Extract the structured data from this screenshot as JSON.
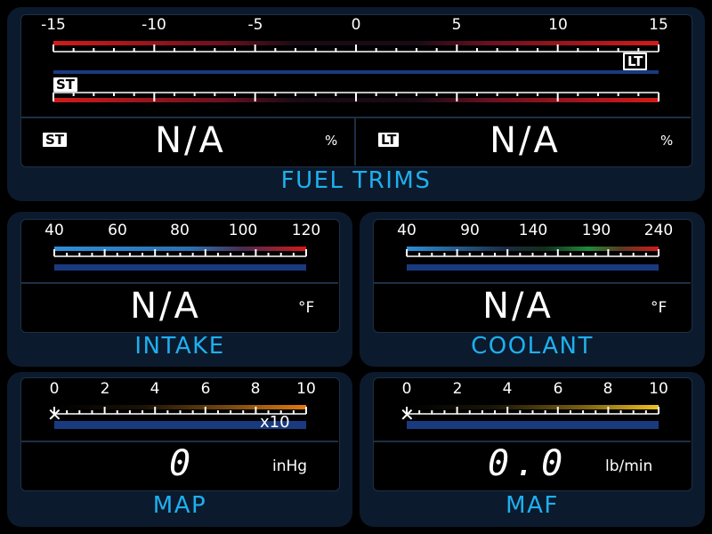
{
  "colors": {
    "accent": "#1eb0ee",
    "panel": "#0c1a2e",
    "bar_track": "#1a3a80",
    "red": "#d41a1a",
    "blue": "#2d8fd8",
    "orange": "#e07a10",
    "yellow": "#f0c020",
    "green": "#1f8a3a"
  },
  "fuel_trims": {
    "label": "FUEL TRIMS",
    "scale": [
      "-15",
      "-10",
      "-5",
      "0",
      "5",
      "10",
      "15"
    ],
    "lt_badge": "LT",
    "st_badge": "ST",
    "st": {
      "badge": "ST",
      "value": "N/A",
      "unit": "%"
    },
    "lt": {
      "badge": "LT",
      "value": "N/A",
      "unit": "%"
    }
  },
  "intake": {
    "label": "INTAKE",
    "scale": [
      "40",
      "60",
      "80",
      "100",
      "120"
    ],
    "value": "N/A",
    "unit": "°F"
  },
  "coolant": {
    "label": "COOLANT",
    "scale": [
      "40",
      "90",
      "140",
      "190",
      "240"
    ],
    "value": "N/A",
    "unit": "°F"
  },
  "map": {
    "label": "MAP",
    "scale": [
      "0",
      "2",
      "4",
      "6",
      "8",
      "10"
    ],
    "multiplier": "x10",
    "value": "0",
    "unit": "inHg"
  },
  "maf": {
    "label": "MAF",
    "scale": [
      "0",
      "2",
      "4",
      "6",
      "8",
      "10"
    ],
    "value": "0.0",
    "unit": "lb/min"
  }
}
